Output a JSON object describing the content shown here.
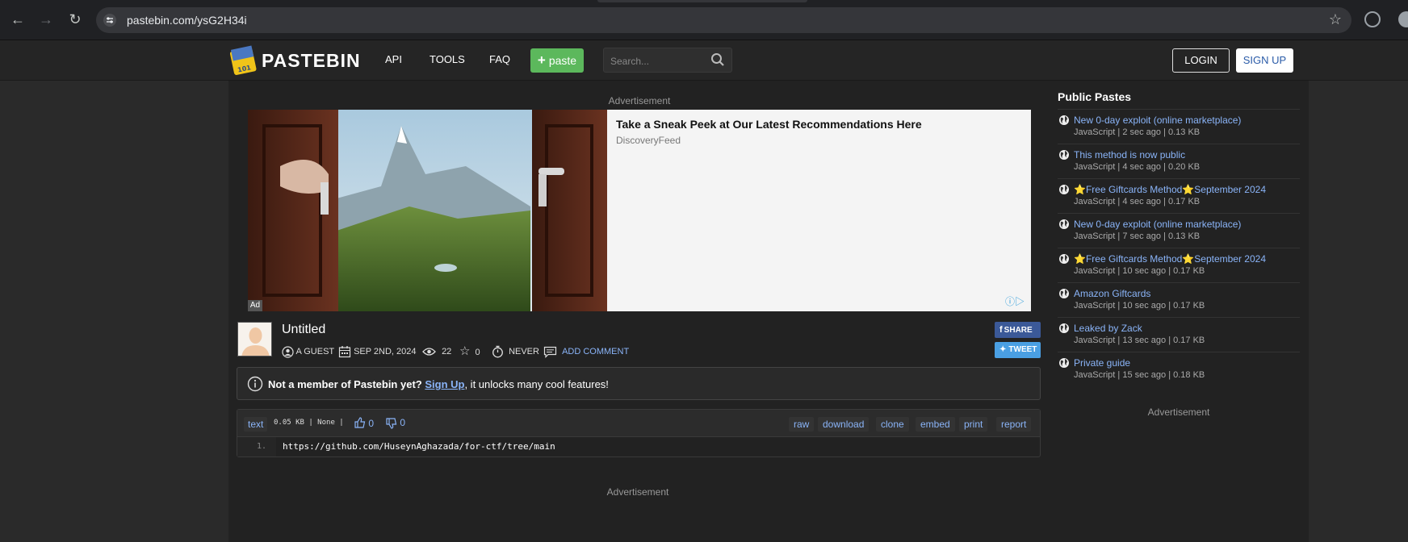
{
  "browser": {
    "url": "pastebin.com/ysG2H34i"
  },
  "header": {
    "logo_text": "PASTEBIN",
    "nav": [
      "API",
      "TOOLS",
      "FAQ"
    ],
    "paste_label": "paste",
    "search_placeholder": "Search...",
    "login_label": "LOGIN",
    "signup_label": "SIGN UP"
  },
  "ads": {
    "label": "Advertisement",
    "title": "Take a Sneak Peek at Our Latest Recommendations Here",
    "source": "DiscoveryFeed",
    "badge": "Ad"
  },
  "paste": {
    "title": "Untitled",
    "author": "A GUEST",
    "date": "SEP 2ND, 2024",
    "views": "22",
    "stars": "0",
    "expires": "NEVER",
    "add_comment": "ADD COMMENT",
    "share_label": "SHARE",
    "tweet_label": "TWEET"
  },
  "notice": {
    "bold": "Not a member of Pastebin yet?",
    "link": "Sign Up",
    "rest": ", it unlocks many cool features!"
  },
  "code": {
    "format": "text",
    "stats": "0.05 KB | None |",
    "likes": "0",
    "dislikes": "0",
    "actions": [
      "raw",
      "download",
      "clone",
      "embed",
      "print",
      "report"
    ],
    "line_number": "1.",
    "line": "https://github.com/HuseynAghazada/for-ctf/tree/main"
  },
  "sidebar": {
    "title": "Public Pastes",
    "items": [
      {
        "title": "New 0-day exploit (online marketplace)",
        "meta": "JavaScript | 2 sec ago | 0.13 KB"
      },
      {
        "title": "This method is now public",
        "meta": "JavaScript | 4 sec ago | 0.20 KB"
      },
      {
        "title": "⭐Free Giftcards Method⭐September 2024",
        "meta": "JavaScript | 4 sec ago | 0.17 KB"
      },
      {
        "title": "New 0-day exploit (online marketplace)",
        "meta": "JavaScript | 7 sec ago | 0.13 KB"
      },
      {
        "title": "⭐Free Giftcards Method⭐September 2024",
        "meta": "JavaScript | 10 sec ago | 0.17 KB"
      },
      {
        "title": "Amazon Giftcards",
        "meta": "JavaScript | 10 sec ago | 0.17 KB"
      },
      {
        "title": "Leaked by Zack",
        "meta": "JavaScript | 13 sec ago | 0.17 KB"
      },
      {
        "title": "Private guide",
        "meta": "JavaScript | 15 sec ago | 0.18 KB"
      }
    ],
    "ad_label": "Advertisement"
  }
}
